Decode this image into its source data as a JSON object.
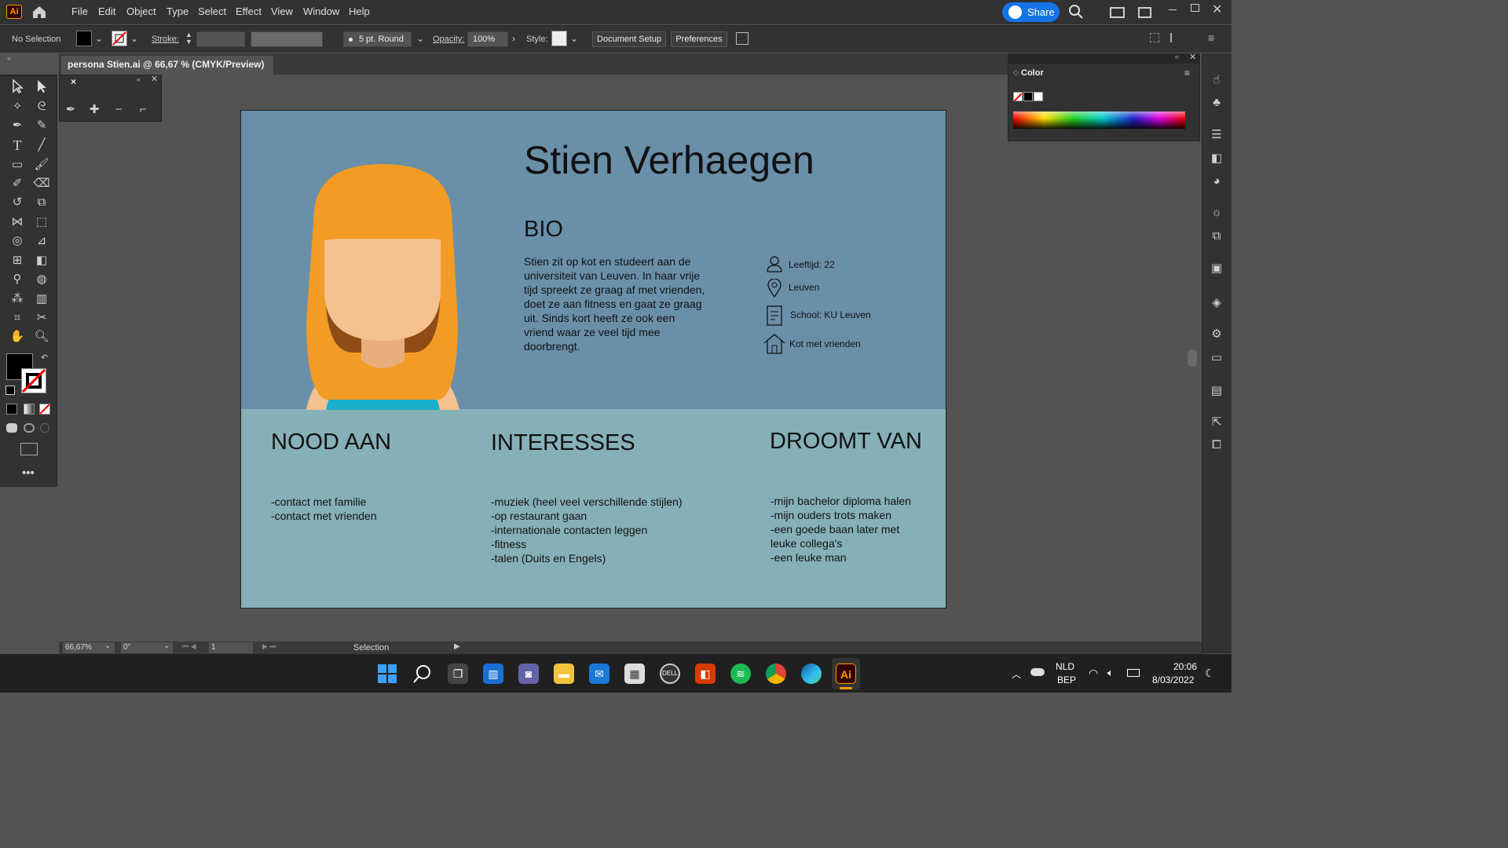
{
  "app": {
    "logo": "Ai",
    "menus": [
      "File",
      "Edit",
      "Object",
      "Type",
      "Select",
      "Effect",
      "View",
      "Window",
      "Help"
    ],
    "share": "Share"
  },
  "control": {
    "selection": "No Selection",
    "stroke_label": "Stroke:",
    "brush": "5 pt. Round",
    "opacity_label": "Opacity:",
    "opacity": "100%",
    "style_label": "Style:",
    "doc_setup": "Document Setup",
    "preferences": "Preferences"
  },
  "tab": {
    "title": "persona Stien.ai @ 66,67 % (CMYK/Preview)",
    "close": "×"
  },
  "color_panel": {
    "title": "Color"
  },
  "persona": {
    "name": "Stien Verhaegen",
    "bio_heading": "BIO",
    "bio_lines": [
      "Stien zit op kot en studeert aan de",
      "universiteit van Leuven. In haar vrije",
      "tijd spreekt ze graag af met vrienden,",
      "doet ze aan fitness en gaat ze graag",
      "uit. Sinds kort heeft ze ook een",
      "vriend waar ze veel tijd mee",
      "doorbrengt."
    ],
    "info": {
      "age": "Leeftijd: 22",
      "city": "Leuven",
      "school": "School: KU Leuven",
      "home": "Kot met vrienden"
    },
    "needs": {
      "heading": "NOOD AAN",
      "items": [
        "-contact met familie",
        "-contact met vrienden"
      ]
    },
    "interests": {
      "heading": "INTERESSES",
      "items": [
        "-muziek (heel veel verschillende stijlen)",
        "-op restaurant gaan",
        "-internationale contacten leggen",
        "-fitness",
        "-talen (Duits en Engels)"
      ]
    },
    "dreams": {
      "heading": "DROOMT VAN",
      "items": [
        "-mijn bachelor diploma halen",
        "-mijn ouders trots maken",
        "-een goede baan later met",
        "leuke collega's",
        "-een leuke man"
      ]
    },
    "colors": {
      "top": "#6a8fa9",
      "bottom": "#86b0b8",
      "hair": "#f29b25",
      "skin": "#f5c190",
      "shirt": "#1aaecd",
      "shadow": "#8f4c15"
    }
  },
  "status": {
    "zoom": "66,67%",
    "rotation": "0°",
    "artboard": "1",
    "tool": "Selection"
  },
  "taskbar": {
    "lang": "NLD",
    "layout": "BEP",
    "time": "20:06",
    "date": "8/03/2022"
  }
}
